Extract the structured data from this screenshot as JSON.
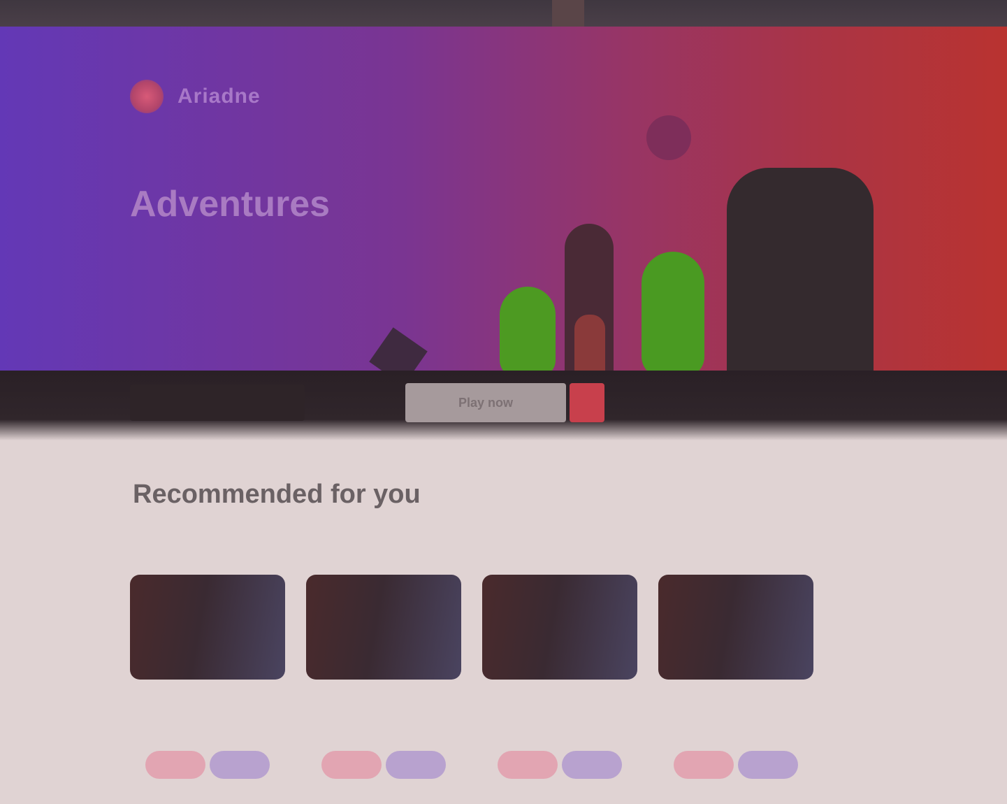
{
  "brand": {
    "name": "Ariadne",
    "logo_icon": "logo-circle-icon"
  },
  "hero": {
    "title": "Adventures",
    "subtitle": "",
    "primary_cta": "",
    "secondary_cta": "Play now"
  },
  "section": {
    "title": "Recommended for you"
  },
  "cards": [
    {
      "meta": "",
      "tag_a": "",
      "tag_b": ""
    },
    {
      "meta": "",
      "tag_a": "",
      "tag_b": ""
    },
    {
      "meta": "",
      "tag_a": "",
      "tag_b": ""
    },
    {
      "meta": "",
      "tag_a": "",
      "tag_b": ""
    }
  ],
  "colors": {
    "hero_start": "#6338b6",
    "hero_end": "#b93330",
    "accent_green": "#4a9a22",
    "accent_red": "#c8404c",
    "background": "#e0d3d3"
  }
}
